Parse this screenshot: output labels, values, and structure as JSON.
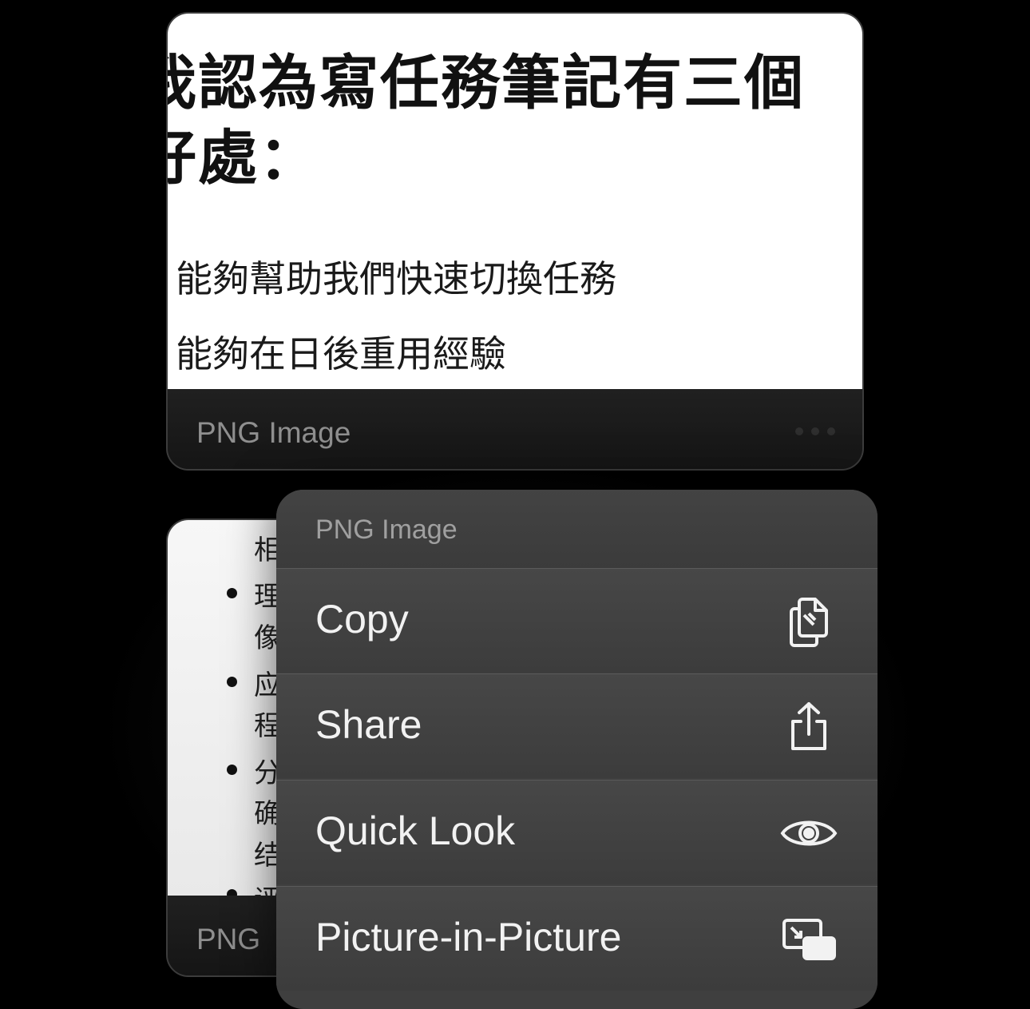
{
  "card1": {
    "heading_line1": "我認為寫任務筆記有三個",
    "heading_line2": "好處：",
    "line1": "能夠幫助我們快速切換任務",
    "line2": "能夠在日後重用經驗",
    "footer_label": "PNG Image"
  },
  "card2": {
    "fragments": [
      "相",
      "理",
      "像",
      "应",
      "程",
      "分",
      "确",
      "结",
      "评"
    ],
    "footer_label": "PNG"
  },
  "menu": {
    "title": "PNG Image",
    "items": [
      {
        "label": "Copy",
        "icon": "copy-icon"
      },
      {
        "label": "Share",
        "icon": "share-icon"
      },
      {
        "label": "Quick Look",
        "icon": "eye-icon"
      },
      {
        "label": "Picture-in-Picture",
        "icon": "picture-in-picture-icon"
      }
    ]
  },
  "colors": {
    "background": "#000000",
    "menu_bg": "#3f3f3f",
    "menu_text": "#f2f2f2",
    "secondary_text": "#8f8f8f"
  }
}
